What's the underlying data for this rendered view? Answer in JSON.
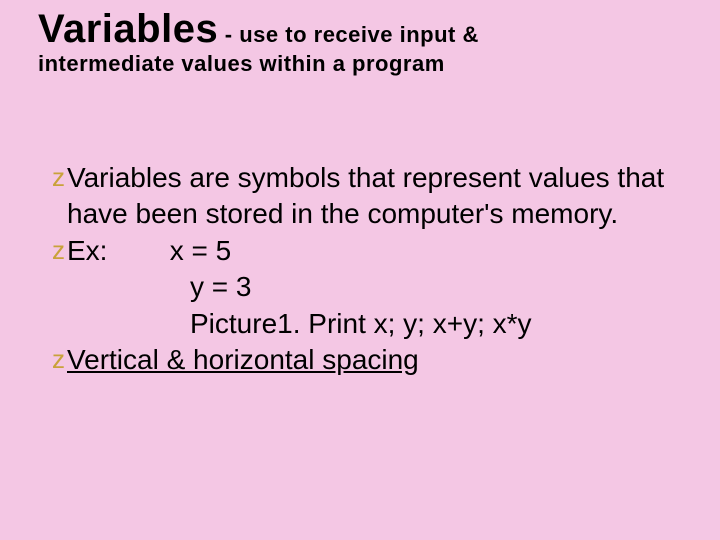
{
  "title": {
    "main": "Variables",
    "rest": " - use to receive input &",
    "line2": "intermediate values within a program"
  },
  "bullets": {
    "b1": "Variables are symbols that represent values that have been stored in the computer's memory.",
    "b2_label": "Ex:",
    "b2_eq1": "x = 5",
    "b2_eq2": "y = 3",
    "b2_eq3": "Picture1. Print x; y; x+y; x*y",
    "b3": "Vertical & horizontal spacing"
  },
  "glyph": "z"
}
